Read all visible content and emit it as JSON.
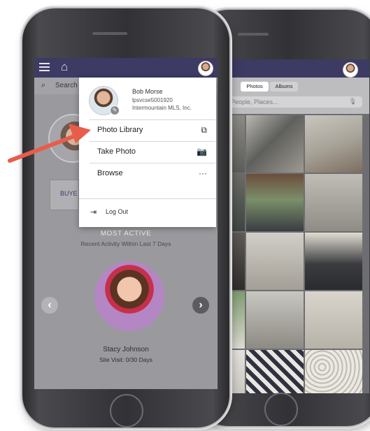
{
  "front_app": {
    "search_label": "Search",
    "buyer_tab_label": "BUYE",
    "activity_title": "MOST ACTIVE",
    "activity_subtitle": "Recent Activity Within Last 7 Days",
    "featured_contact": {
      "name": "Stacy Johnson",
      "site_visit": "Site Visit: 0/30 Days"
    },
    "prev_glyph": "‹",
    "next_glyph": "›"
  },
  "menu": {
    "user": {
      "name": "Bob Morse",
      "id": "lpsvcse5001920",
      "organization": "Intermountain MLS, Inc."
    },
    "options": [
      {
        "label": "Photo Library",
        "icon": "photo-library-icon"
      },
      {
        "label": "Take Photo",
        "icon": "camera-icon"
      },
      {
        "label": "Browse",
        "icon": "more-icon"
      }
    ],
    "logout_label": "Log Out"
  },
  "gallery": {
    "tabs": [
      "Photos",
      "Albums"
    ],
    "active_tab": "Photos",
    "search_placeholder": "People, Places..."
  },
  "colors": {
    "navbar": "#3d3a63",
    "arrow": "#e85c4a",
    "overlay": "#9a9a9e"
  }
}
